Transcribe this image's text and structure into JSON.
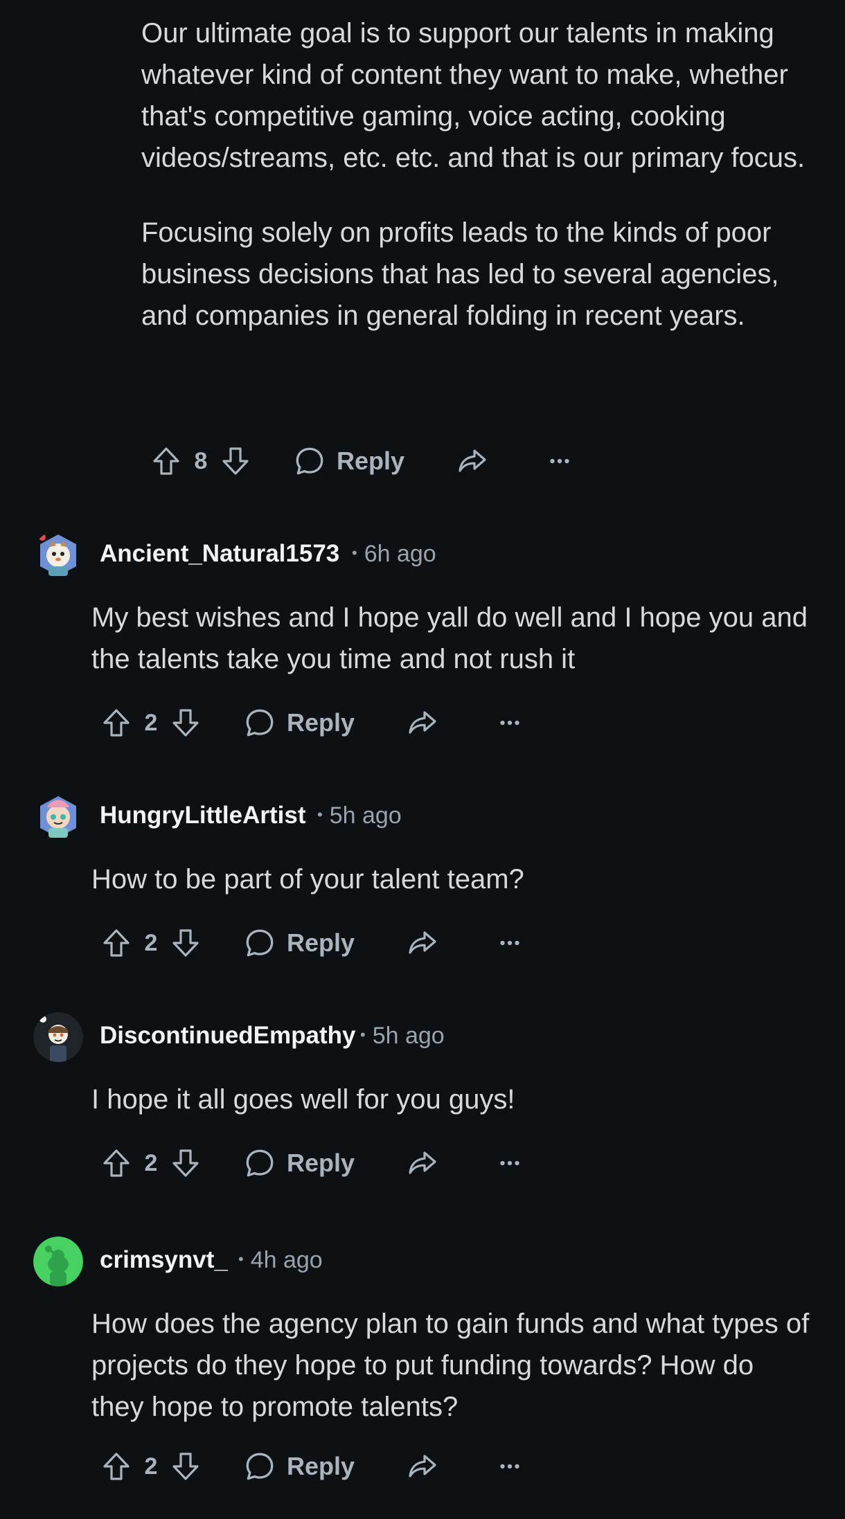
{
  "top_comment": {
    "paragraphs": [
      "Our ultimate goal is to support our talents in making whatever kind of content they want to make, whether that's competitive gaming, voice acting, cooking videos/streams, etc. etc. and that is our primary focus.",
      "Focusing solely on profits leads to the kinds of poor business decisions that has led to several agencies, and companies in general folding in recent years."
    ],
    "score": "8",
    "reply_label": "Reply"
  },
  "comments": [
    {
      "username": "Ancient_Natural1573",
      "time": "6h ago",
      "body": "My best wishes and I hope yall do well and I hope you and the talents take you time and not rush it",
      "score": "2",
      "reply_label": "Reply",
      "avatar": "snoo-avatar-blue"
    },
    {
      "username": "HungryLittleArtist",
      "time": "5h ago",
      "body": "How to be part of your talent team?",
      "score": "2",
      "reply_label": "Reply",
      "avatar": "snoo-avatar-blue"
    },
    {
      "username": "DiscontinuedEmpathy",
      "time": "5h ago",
      "body": "I hope it all goes well for you guys!",
      "score": "2",
      "reply_label": "Reply",
      "avatar": "snoo-avatar-dark"
    },
    {
      "username": "crimsynvt_",
      "time": "4h ago",
      "body": "How does the agency plan to gain funds and what types of projects do they hope to put funding towards? How do they hope to promote talents?",
      "score": "2",
      "reply_label": "Reply",
      "avatar": "snoo-avatar-green"
    }
  ],
  "colors": {
    "background": "#0e1113",
    "text": "#d7dadc",
    "muted": "#aab4bc",
    "username": "#f2f3f5",
    "avatar_green": "#46d160"
  }
}
